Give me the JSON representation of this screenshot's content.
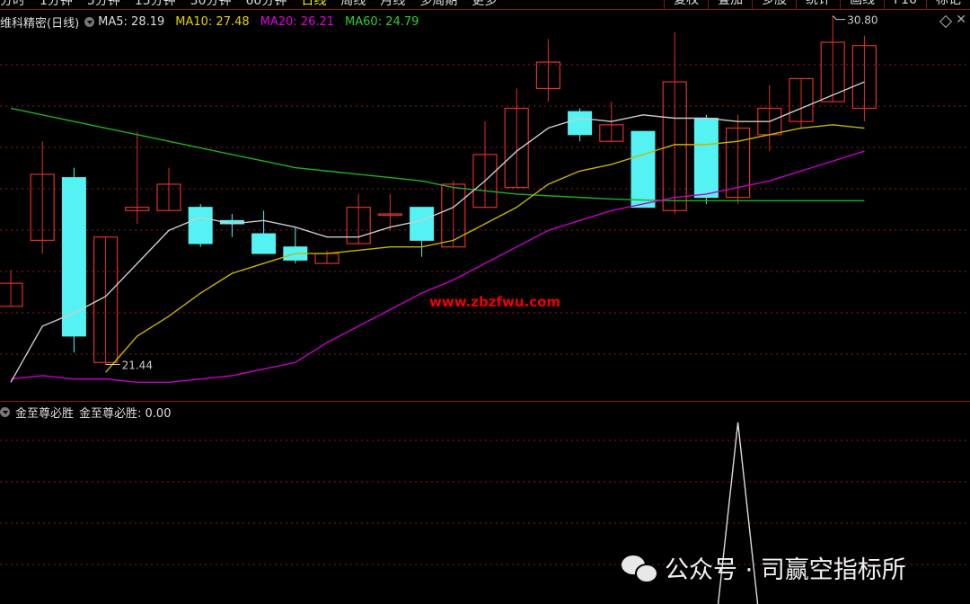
{
  "topbar": {
    "periods": [
      "分时",
      "1分钟",
      "5分钟",
      "15分钟",
      "30分钟",
      "60分钟",
      "日线",
      "周线",
      "月线",
      "多周期",
      "更多"
    ],
    "active_index": 6,
    "right_buttons": [
      "复权",
      "叠加",
      "多股",
      "统计",
      "画线",
      "F10",
      "标记"
    ]
  },
  "titlebar": {
    "stock": "维科精密(日线)",
    "ma5_label": "MA5: 28.19",
    "ma10_label": "MA10: 27.48",
    "ma20_label": "MA20: 26.21",
    "ma60_label": "MA60: 24.79"
  },
  "colors": {
    "up": "#e0302a",
    "down": "#54f2f2",
    "ma5": "#cccccc",
    "ma10": "#c8b400",
    "ma20": "#c800c8",
    "ma60": "#20b020",
    "grid": "#8a1e1e",
    "watermark_text": "#ee0000"
  },
  "chart_data": {
    "type": "candlestick",
    "price_range": [
      20.5,
      31.5
    ],
    "high_annotation": "30.80",
    "low_annotation": "21.44",
    "candles": [
      {
        "o": 23.2,
        "c": 23.9,
        "h": 24.3,
        "l": 23.2
      },
      {
        "o": 25.2,
        "c": 27.2,
        "h": 28.2,
        "l": 24.8
      },
      {
        "o": 27.1,
        "c": 22.3,
        "h": 27.4,
        "l": 21.8
      },
      {
        "o": 21.5,
        "c": 25.3,
        "h": 25.3,
        "l": 21.44
      },
      {
        "o": 26.1,
        "c": 26.2,
        "h": 28.5,
        "l": 25.7
      },
      {
        "o": 26.1,
        "c": 26.9,
        "h": 27.4,
        "l": 26.1
      },
      {
        "o": 26.2,
        "c": 25.1,
        "h": 26.3,
        "l": 25.0
      },
      {
        "o": 25.8,
        "c": 25.7,
        "h": 26.0,
        "l": 25.3
      },
      {
        "o": 25.4,
        "c": 24.8,
        "h": 26.1,
        "l": 24.8
      },
      {
        "o": 25.0,
        "c": 24.6,
        "h": 25.6,
        "l": 24.5
      },
      {
        "o": 24.5,
        "c": 24.8,
        "h": 24.9,
        "l": 24.5
      },
      {
        "o": 25.1,
        "c": 26.2,
        "h": 26.6,
        "l": 25.1
      },
      {
        "o": 26.0,
        "c": 26.0,
        "h": 26.6,
        "l": 25.5
      },
      {
        "o": 26.2,
        "c": 25.2,
        "h": 26.2,
        "l": 24.7
      },
      {
        "o": 25.0,
        "c": 26.9,
        "h": 27.0,
        "l": 25.0
      },
      {
        "o": 26.2,
        "c": 27.8,
        "h": 28.8,
        "l": 26.2
      },
      {
        "o": 26.8,
        "c": 29.2,
        "h": 29.8,
        "l": 26.8
      },
      {
        "o": 29.8,
        "c": 30.6,
        "h": 31.3,
        "l": 29.4
      },
      {
        "o": 29.1,
        "c": 28.4,
        "h": 29.2,
        "l": 28.2
      },
      {
        "o": 28.2,
        "c": 28.7,
        "h": 29.4,
        "l": 28.2
      },
      {
        "o": 28.5,
        "c": 26.2,
        "h": 28.5,
        "l": 26.2
      },
      {
        "o": 26.1,
        "c": 30.0,
        "h": 31.5,
        "l": 26.0
      },
      {
        "o": 28.9,
        "c": 26.5,
        "h": 29.0,
        "l": 26.3
      },
      {
        "o": 26.5,
        "c": 28.6,
        "h": 29.0,
        "l": 26.3
      },
      {
        "o": 28.4,
        "c": 29.2,
        "h": 29.9,
        "l": 27.9
      },
      {
        "o": 28.8,
        "c": 30.1,
        "h": 30.1,
        "l": 28.6
      },
      {
        "o": 29.4,
        "c": 31.2,
        "h": 32.0,
        "l": 29.4
      },
      {
        "o": 29.2,
        "c": 31.1,
        "h": 31.4,
        "l": 28.8
      }
    ],
    "ma5": [
      20.9,
      22.6,
      23.0,
      23.5,
      24.5,
      25.5,
      25.9,
      25.7,
      25.8,
      25.6,
      25.3,
      25.3,
      25.6,
      25.8,
      26.2,
      27.0,
      27.9,
      28.6,
      28.9,
      28.8,
      29.0,
      28.9,
      28.9,
      28.8,
      28.8,
      29.2,
      29.6,
      30.0
    ],
    "ma10": [
      null,
      null,
      null,
      21.2,
      22.3,
      22.9,
      23.6,
      24.2,
      24.5,
      24.8,
      24.8,
      24.9,
      25.0,
      25.0,
      25.2,
      25.7,
      26.2,
      26.9,
      27.3,
      27.5,
      27.8,
      28.1,
      28.1,
      28.2,
      28.4,
      28.6,
      28.7,
      28.6
    ],
    "ma20": [
      21.0,
      21.1,
      21.0,
      21.0,
      20.9,
      20.9,
      21.0,
      21.1,
      21.3,
      21.5,
      22.1,
      22.6,
      23.1,
      23.6,
      24.0,
      24.5,
      25.0,
      25.5,
      25.8,
      26.1,
      26.3,
      26.5,
      26.6,
      26.8,
      27.0,
      27.3,
      27.6,
      27.9
    ],
    "ma60": [
      29.2,
      29.0,
      28.8,
      28.6,
      28.4,
      28.2,
      28.0,
      27.8,
      27.6,
      27.4,
      27.3,
      27.2,
      27.1,
      27.0,
      26.8,
      26.7,
      26.6,
      26.55,
      26.5,
      26.45,
      26.42,
      26.4,
      26.4,
      26.4,
      26.4,
      26.4,
      26.4,
      26.4
    ]
  },
  "watermark_site": "www.zbzfwu.com",
  "indicator": {
    "name": "金至尊必胜",
    "label": "金至尊必胜: 0.00",
    "signal_index": 23
  },
  "footer_watermark": "公众号 · 司赢空指标所"
}
